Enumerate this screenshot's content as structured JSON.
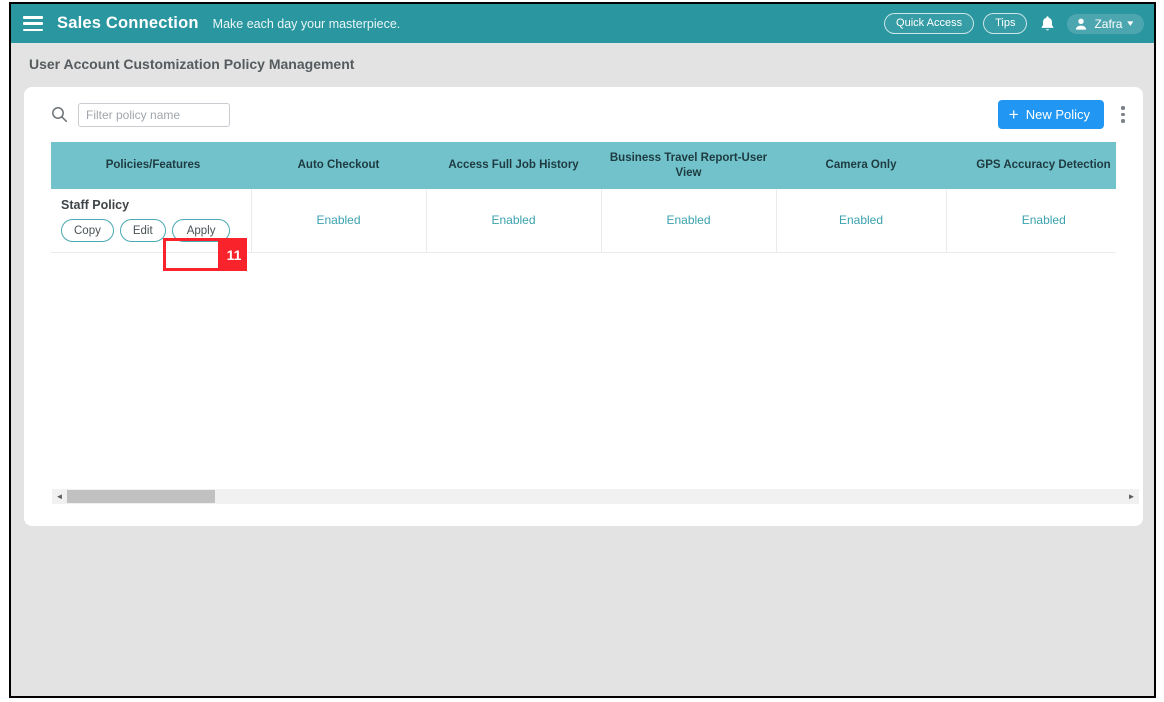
{
  "appbar": {
    "menu_icon": "hamburger-icon",
    "brand": "Sales Connection",
    "tagline": "Make each day your masterpiece.",
    "quick_access_label": "Quick Access",
    "tips_label": "Tips",
    "notification_icon": "bell-icon",
    "user_name": "Zafra",
    "user_icon": "person-icon",
    "caret_icon": "chevron-down-icon",
    "bg_color": "#2a96a0"
  },
  "page": {
    "title": "User Account Customization Policy Management",
    "bg_color": "#e3e3e3"
  },
  "toolbar": {
    "search_icon": "search-icon",
    "filter_value": "",
    "filter_placeholder": "Filter policy name",
    "new_policy_label": "New Policy",
    "new_policy_plus": "+",
    "new_policy_color": "#2196f3",
    "kebab_icon": "more-vertical-icon"
  },
  "table": {
    "header_color": "#72c2cc",
    "columns": [
      "Policies/Features",
      "Auto Checkout",
      "Access Full Job History",
      "Business Travel Report-User View",
      "Camera Only",
      "GPS Accuracy Detection"
    ],
    "rows": [
      {
        "policy_name": "Staff Policy",
        "actions": [
          "Copy",
          "Edit",
          "Apply"
        ],
        "values": [
          "Enabled",
          "Enabled",
          "Enabled",
          "Enabled",
          "Enabled"
        ]
      }
    ]
  },
  "scrollbar": {
    "left_arrow": "◄",
    "right_arrow": "►"
  },
  "annotation": {
    "step_number": "11",
    "color": "#f8232b"
  }
}
